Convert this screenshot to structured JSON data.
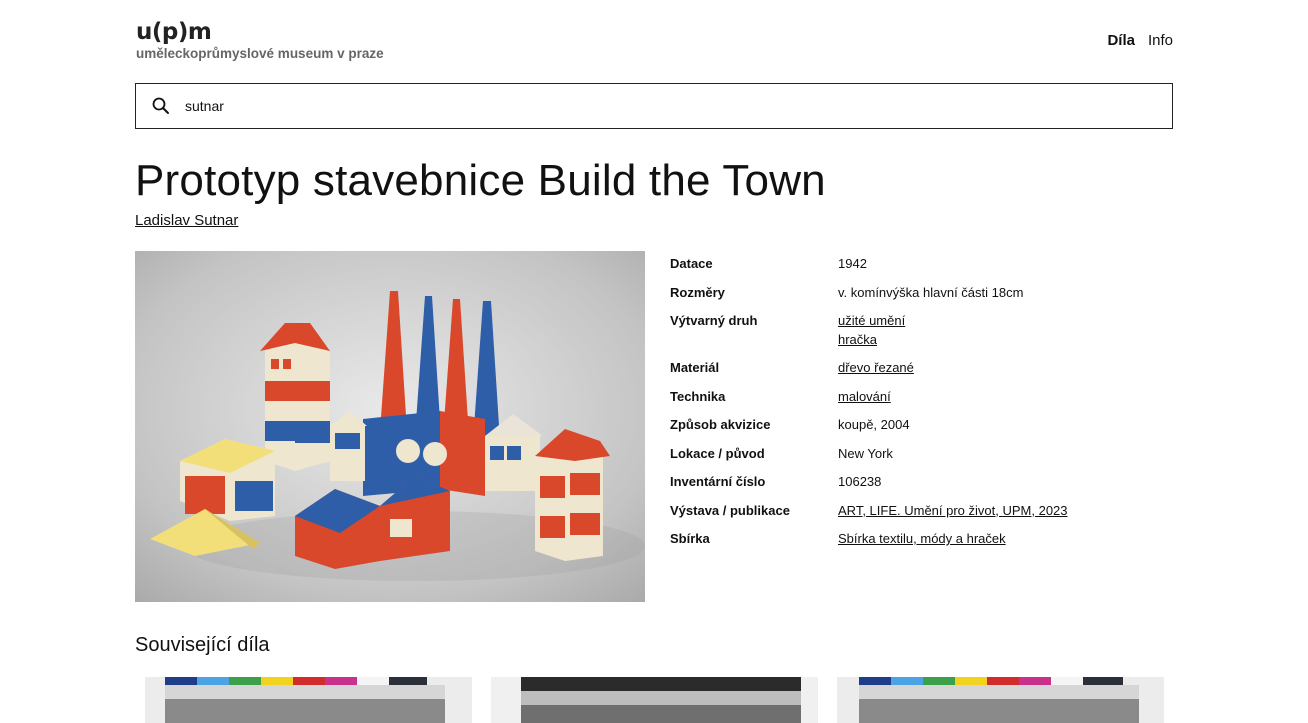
{
  "header": {
    "logo_mark": "u(p)m",
    "logo_sub": "uměleckoprůmyslové museum v praze",
    "nav": [
      {
        "label": "Díla",
        "active": true
      },
      {
        "label": "Info",
        "active": false
      }
    ]
  },
  "search": {
    "value": "sutnar",
    "icon": "search-icon"
  },
  "artwork": {
    "title": "Prototyp stavebnice Build the Town",
    "author": "Ladislav Sutnar"
  },
  "metadata": [
    {
      "label": "Datace",
      "values": [
        "1942"
      ],
      "link": false
    },
    {
      "label": "Rozměry",
      "values": [
        "v. komínvýška hlavní části 18cm"
      ],
      "link": false
    },
    {
      "label": "Výtvarný druh",
      "values": [
        "užité umění",
        "hračka"
      ],
      "link": true
    },
    {
      "label": "Materiál",
      "values": [
        "dřevo řezané"
      ],
      "link": true
    },
    {
      "label": "Technika",
      "values": [
        "malování"
      ],
      "link": true
    },
    {
      "label": "Způsob akvizice",
      "values": [
        "koupě, 2004"
      ],
      "link": false
    },
    {
      "label": "Lokace / původ",
      "values": [
        "New York"
      ],
      "link": false
    },
    {
      "label": "Inventární číslo",
      "values": [
        "106238"
      ],
      "link": false
    },
    {
      "label": "Výstava / publikace",
      "values": [
        "ART, LIFE. Umění pro život, UPM, 2023"
      ],
      "link": true
    },
    {
      "label": "Sbírka",
      "values": [
        "Sbírka textilu, módy a hraček"
      ],
      "link": true
    }
  ],
  "related": {
    "heading": "Související díla"
  },
  "colors": {
    "text": "#111111",
    "logo_sub": "#666666",
    "block_red": "#d9482b",
    "block_blue": "#2f5ea8",
    "block_cream": "#efe6cf",
    "block_yellow": "#f2df7a"
  }
}
